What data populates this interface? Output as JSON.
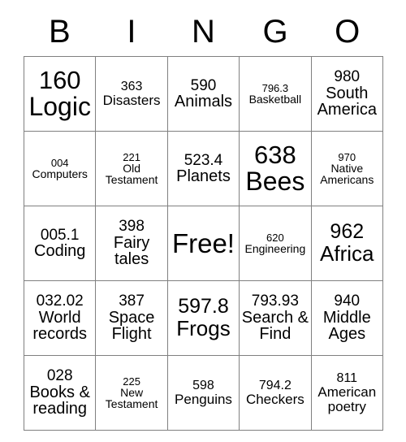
{
  "card": {
    "header_letters": [
      "B",
      "I",
      "N",
      "G",
      "O"
    ],
    "grid_color": "#808080",
    "text_color": "#000000",
    "background": "#ffffff",
    "rows": [
      [
        {
          "number": "160",
          "label": "Logic",
          "size": "xl"
        },
        {
          "number": "363",
          "label": "Disasters",
          "size": "s"
        },
        {
          "number": "590",
          "label": "Animals",
          "size": "m"
        },
        {
          "number": "796.3",
          "label": "Basketball",
          "size": "xs"
        },
        {
          "number": "980",
          "label": "South America",
          "size": "m"
        }
      ],
      [
        {
          "number": "004",
          "label": "Computers",
          "size": "xs"
        },
        {
          "number": "221",
          "label": "Old Testament",
          "size": "xs"
        },
        {
          "number": "523.4",
          "label": "Planets",
          "size": "m"
        },
        {
          "number": "638",
          "label": "Bees",
          "size": "xl"
        },
        {
          "number": "970",
          "label": "Native Americans",
          "size": "xs"
        }
      ],
      [
        {
          "number": "005.1",
          "label": "Coding",
          "size": "m"
        },
        {
          "number": "398",
          "label": "Fairy tales",
          "size": "m"
        },
        {
          "number": "",
          "label": "Free!",
          "size": "free"
        },
        {
          "number": "620",
          "label": "Engineering",
          "size": "xs"
        },
        {
          "number": "962",
          "label": "Africa",
          "size": "l"
        }
      ],
      [
        {
          "number": "032.02",
          "label": "World records",
          "size": "m"
        },
        {
          "number": "387",
          "label": "Space Flight",
          "size": "m"
        },
        {
          "number": "597.8",
          "label": "Frogs",
          "size": "l"
        },
        {
          "number": "793.93",
          "label": "Search & Find",
          "size": "m"
        },
        {
          "number": "940",
          "label": "Middle Ages",
          "size": "m"
        }
      ],
      [
        {
          "number": "028",
          "label": "Books & reading",
          "size": "m"
        },
        {
          "number": "225",
          "label": "New Testament",
          "size": "xs"
        },
        {
          "number": "598",
          "label": "Penguins",
          "size": "s"
        },
        {
          "number": "794.2",
          "label": "Checkers",
          "size": "s"
        },
        {
          "number": "811",
          "label": "American poetry",
          "size": "s"
        }
      ]
    ]
  }
}
